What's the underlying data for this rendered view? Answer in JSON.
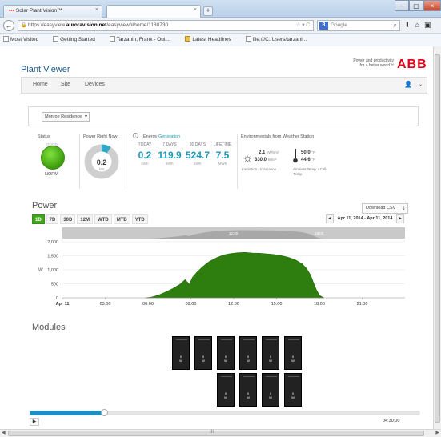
{
  "browser": {
    "tabs": [
      {
        "title": "Solar Plant Vision™",
        "close": "×"
      },
      {
        "title": "",
        "close": "×"
      }
    ],
    "new_tab": "+",
    "window_buttons": [
      "–",
      "▢",
      "×"
    ],
    "url_prefix": "https://easyview.",
    "url_host": "auroravision.net",
    "url_rest": "/easyview/#home/1180730",
    "search_engine": "8",
    "search_placeholder": "Google",
    "bookmarks": [
      "Most Visited",
      "Getting Started",
      "Tarzanin, Frank - Outl...",
      "Latest Headlines",
      "file:///C:/Users/tarzani..."
    ]
  },
  "header": {
    "app_title": "Plant Viewer",
    "tagline_1": "Power and productivity",
    "tagline_2": "for a better world™",
    "logo": "ABB"
  },
  "menu": {
    "items": [
      "Home",
      "Site",
      "Devices"
    ],
    "user_icon": "👤",
    "chevron": "⌄"
  },
  "site": {
    "selected": "Monroe Residence"
  },
  "status": {
    "heading": "Status",
    "label": "NORM",
    "small": "GOOD"
  },
  "power_now": {
    "heading": "Power Right Now",
    "value": "0.2",
    "unit": "kW",
    "fraction": 0.09
  },
  "energy": {
    "heading_prefix": "Energy",
    "heading_link": "Generation",
    "columns": [
      {
        "label": "TODAY",
        "value": "0.2",
        "unit": "kWh"
      },
      {
        "label": "7 DAYS",
        "value": "119.9",
        "unit": "kWh"
      },
      {
        "label": "30 DAYS",
        "value": "524.7",
        "unit": "kWh"
      },
      {
        "label": "LIFETIME",
        "value": "7.5",
        "unit": "MWh"
      }
    ]
  },
  "weather": {
    "heading": "Environmentals from Weather Station",
    "irradiance_1": "2.1",
    "irradiance_1_unit": "kWh/m²",
    "irradiance_2": "330.0",
    "irradiance_2_unit": "W/m²",
    "irradiance_caption": "Insolation / Irradiance",
    "temp_1": "50.0",
    "temp_1_unit": "°F",
    "temp_2": "44.6",
    "temp_2_unit": "°F",
    "temp_caption_1": "Ambient Temp. / Cell",
    "temp_caption_2": "Temp."
  },
  "power": {
    "title": "Power",
    "ranges": [
      "1D",
      "7D",
      "30D",
      "12M",
      "WTD",
      "MTD",
      "YTD"
    ],
    "active_range": "1D",
    "download_label": "Download CSV",
    "prev": "◀",
    "next": "▶",
    "date_range": "Apr 11, 2014 - Apr 11, 2014"
  },
  "chart_data": {
    "type": "area",
    "ylabel": "W",
    "ylim": [
      0,
      2000
    ],
    "yticks": [
      0,
      500,
      1000,
      1500,
      2000
    ],
    "ytick_labels": [
      "0",
      "500",
      "1,000",
      "1,500",
      "2,000"
    ],
    "xlim": [
      0,
      24
    ],
    "xticks": [
      0,
      3,
      6,
      9,
      12,
      15,
      18,
      21
    ],
    "xtick_labels": [
      "Apr 11",
      "03:00",
      "06:00",
      "09:00",
      "12:00",
      "15:00",
      "18:00",
      "21:00"
    ],
    "series": [
      {
        "x": [
          5.8,
          6.2,
          6.7,
          7.2,
          7.7,
          8.2,
          8.6,
          8.9,
          9.1,
          9.4,
          9.8,
          10.3,
          10.8,
          11.3,
          11.8,
          12.3,
          12.8,
          13.3,
          13.8,
          14.3,
          14.8,
          15.3,
          15.8,
          16.3,
          16.8,
          17.1,
          17.4,
          17.6,
          17.8,
          18.0,
          18.3
        ],
        "y": [
          0,
          20,
          90,
          200,
          320,
          470,
          650,
          480,
          720,
          900,
          1100,
          1300,
          1430,
          1530,
          1580,
          1610,
          1620,
          1600,
          1590,
          1570,
          1550,
          1510,
          1450,
          1360,
          1210,
          1050,
          800,
          520,
          280,
          90,
          0
        ]
      }
    ],
    "navigator_labels": [
      "12:00",
      "18:00"
    ],
    "grid": true,
    "colors": {
      "fill": "#2e7d0f",
      "stroke": "#256b0b",
      "grid": "#e4e4e4"
    }
  },
  "modules": {
    "title": "Modules",
    "rows": [
      [
        "0 W",
        "0 W",
        "0 W",
        "0 W",
        "0 W",
        "0 W"
      ],
      [
        "0 W",
        "0 W",
        "0 W",
        "0 W"
      ]
    ]
  },
  "timeline": {
    "fraction": 0.19,
    "play": "▶",
    "time": "04:30:00"
  },
  "scroll": {
    "grip": "III"
  }
}
